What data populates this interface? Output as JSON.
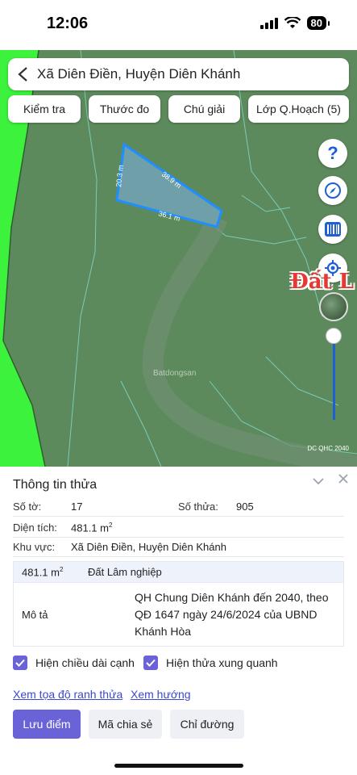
{
  "status_bar": {
    "time": "12:06",
    "battery": "80"
  },
  "header": {
    "title": "Xã Diên Điền, Huyện Diên Khánh"
  },
  "chips": [
    "Kiểm tra",
    "Thước đo",
    "Chú giải",
    "Lớp Q.Hoạch (5)"
  ],
  "map": {
    "edge_labels": [
      "20.3 m",
      "38.9 m",
      "36.1 m"
    ],
    "place_label": "Đất L",
    "watermark": "Batdongsan",
    "corner_label": "DC QHC 2040",
    "colors": {
      "plot_outline": "#1f8fff",
      "plot_fill": "#6f9fa8",
      "forest": "#3cf23c",
      "ground": "#5d8a5c"
    },
    "icons": [
      "help-icon",
      "compass-icon",
      "barcode-icon",
      "locate-icon"
    ]
  },
  "panel": {
    "title": "Thông tin thửa",
    "so_to_label": "Số tờ:",
    "so_to_value": "17",
    "so_thua_label": "Số thửa:",
    "so_thua_value": "905",
    "dien_tich_label": "Diện tích:",
    "dien_tich_value": "481.1 m",
    "khu_vuc_label": "Khu vực:",
    "khu_vuc_value": "Xã Diên Điền, Huyện Diên Khánh",
    "land_area": "481.1 m",
    "land_type": "Đất Lâm nghiệp",
    "mo_ta_label": "Mô tả",
    "mo_ta_value": "QH Chung Diên Khánh đến 2040, theo QĐ 1647 ngày 24/6/2024 của UBND Khánh Hòa",
    "unit_sup": "2"
  },
  "checks": {
    "edge_length": "Hiện chiều dài cạnh",
    "neighbors": "Hiện thửa xung quanh"
  },
  "links": {
    "coords": "Xem tọa độ ranh thửa",
    "direction": "Xem hướng"
  },
  "buttons": {
    "save": "Lưu điểm",
    "share": "Mã chia sẻ",
    "route": "Chỉ đường"
  }
}
